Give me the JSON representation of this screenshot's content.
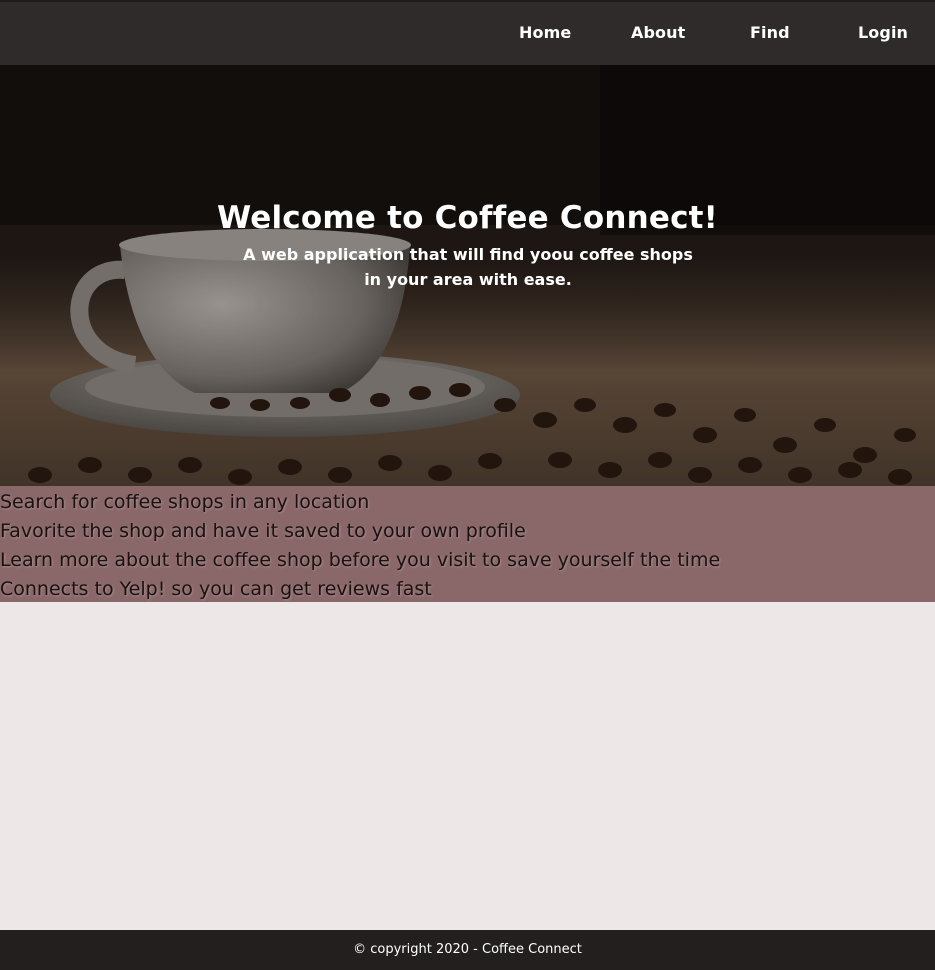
{
  "nav": {
    "items": [
      {
        "label": "Home"
      },
      {
        "label": "About"
      },
      {
        "label": "Find"
      },
      {
        "label": "Login"
      }
    ]
  },
  "hero": {
    "title": "Welcome to Coffee Connect!",
    "subtitle": "A web application that will find yoou coffee shops in your area with ease."
  },
  "features": {
    "items": [
      {
        "text": "Search for coffee shops in any location"
      },
      {
        "text": "Favorite the shop and have it saved to your own profile"
      },
      {
        "text": "Learn more about the coffee shop before you visit to save yourself the time"
      },
      {
        "text": "Connects to Yelp! so you can get reviews fast"
      }
    ]
  },
  "footer": {
    "text": "© copyright 2020 - Coffee Connect"
  },
  "colors": {
    "navbar": "#2f2b2b",
    "features_bg": "#8a686a",
    "page_bg": "#ede7e7",
    "footer": "#231f1f"
  }
}
